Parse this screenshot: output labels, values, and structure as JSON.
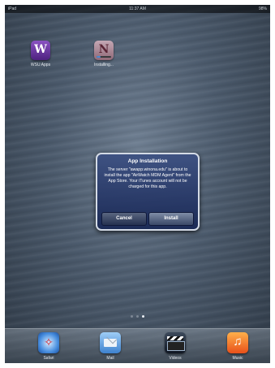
{
  "status_bar": {
    "carrier": "iPad",
    "time": "11:37 AM",
    "battery": "98%"
  },
  "home_apps": [
    {
      "label": "WSU Apps",
      "icon": "wsu-apps-icon"
    },
    {
      "label": "Installing...",
      "icon": "onenote-icon",
      "install_progress": 0.3
    }
  ],
  "alert": {
    "title": "App Installation",
    "message": "The server \"awapp.winona.edu\" is about to install the app \"AirWatch MDM Agent\" from the App Store. Your iTunes account will not be charged for this app.",
    "cancel_label": "Cancel",
    "install_label": "Install"
  },
  "page_indicator": {
    "pages": 3,
    "current": 3
  },
  "dock": [
    {
      "label": "Safari",
      "icon": "safari-icon"
    },
    {
      "label": "Mail",
      "icon": "mail-icon"
    },
    {
      "label": "Videos",
      "icon": "videos-icon"
    },
    {
      "label": "Music",
      "icon": "music-icon"
    }
  ]
}
